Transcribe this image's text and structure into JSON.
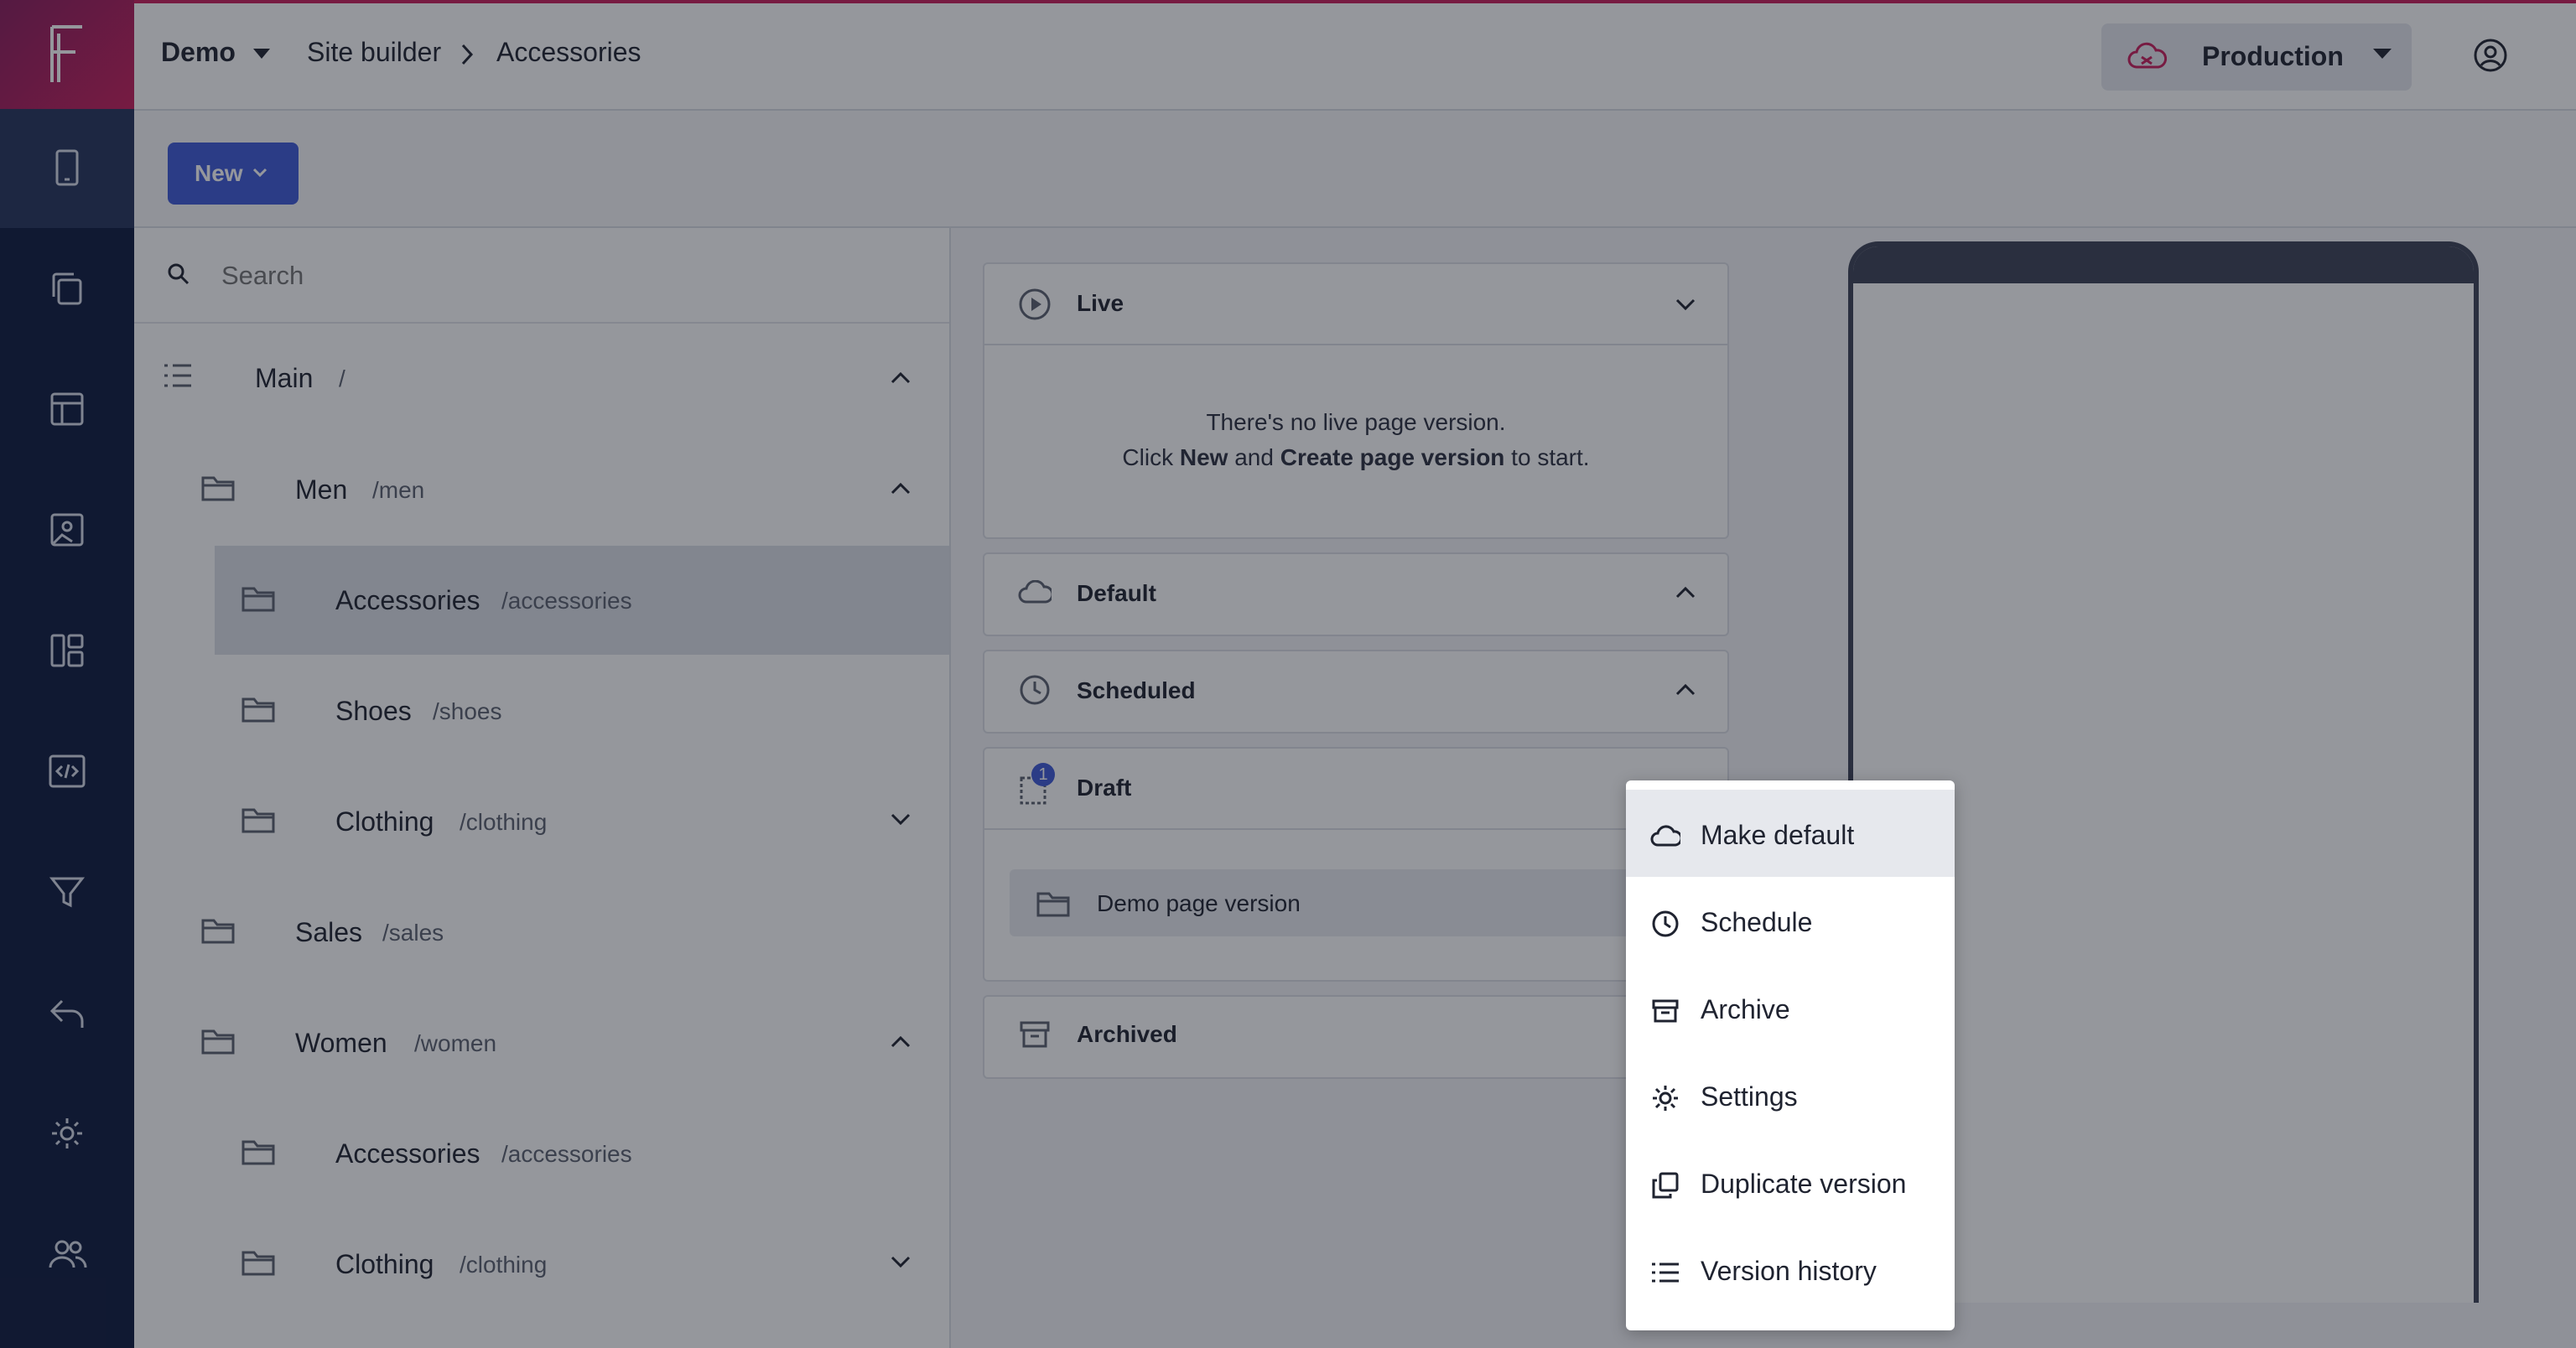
{
  "header": {
    "workspace": "Demo",
    "breadcrumb": [
      "Site builder",
      "Accessories"
    ],
    "environment": "Production"
  },
  "toolbar": {
    "new_label": "New"
  },
  "search": {
    "placeholder": "Search"
  },
  "tree": {
    "main": {
      "name": "Main",
      "path": "/"
    },
    "items": [
      {
        "name": "Men",
        "path": "/men"
      },
      {
        "name": "Accessories",
        "path": "/accessories"
      },
      {
        "name": "Shoes",
        "path": "/shoes"
      },
      {
        "name": "Clothing",
        "path": "/clothing"
      },
      {
        "name": "Sales",
        "path": "/sales"
      },
      {
        "name": "Women",
        "path": "/women"
      },
      {
        "name": "Accessories",
        "path": "/accessories"
      },
      {
        "name": "Clothing",
        "path": "/clothing"
      }
    ]
  },
  "panels": {
    "live": "Live",
    "live_msg_line1": "There's no live page version.",
    "live_msg_click": "Click ",
    "live_msg_new": "New",
    "live_msg_and": " and ",
    "live_msg_create": "Create page version",
    "live_msg_end": " to start.",
    "default": "Default",
    "scheduled": "Scheduled",
    "draft": "Draft",
    "draft_badge": "1",
    "draft_item": "Demo page version",
    "archived": "Archived"
  },
  "menu": {
    "items": [
      {
        "label": "Make default",
        "icon": "cloud-icon"
      },
      {
        "label": "Schedule",
        "icon": "clock-icon"
      },
      {
        "label": "Archive",
        "icon": "archive-icon"
      },
      {
        "label": "Settings",
        "icon": "gear-icon"
      },
      {
        "label": "Duplicate version",
        "icon": "duplicate-icon"
      },
      {
        "label": "Version history",
        "icon": "list-icon"
      }
    ]
  },
  "colors": {
    "accent": "#c81e5b",
    "primary": "#3f5ad8",
    "rail": "#0e1a3e"
  }
}
